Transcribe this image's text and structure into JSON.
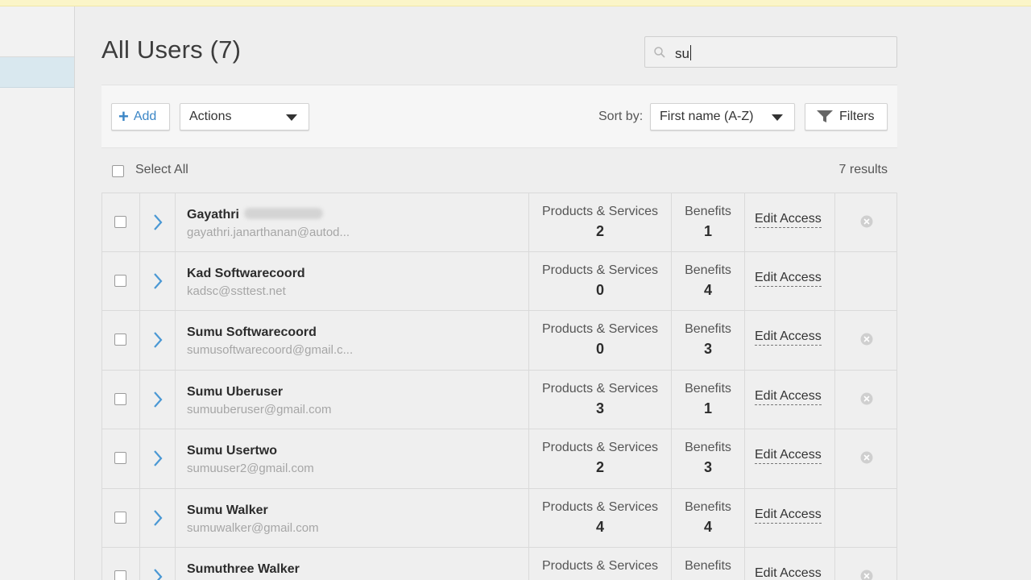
{
  "page": {
    "title": "All Users (7)"
  },
  "search": {
    "value": "su"
  },
  "toolbar": {
    "add_label": "Add",
    "actions_label": "Actions",
    "sort_label": "Sort by:",
    "sort_value": "First name (A-Z)",
    "filters_label": "Filters"
  },
  "select_bar": {
    "select_all_label": "Select All",
    "results_label": "7 results"
  },
  "table": {
    "products_label": "Products & Services",
    "benefits_label": "Benefits",
    "edit_label": "Edit Access",
    "rows": [
      {
        "name": "Gayathri",
        "email": "gayathri.janarthanan@autod...",
        "products": "2",
        "benefits": "1",
        "deletable": true,
        "redacted": true
      },
      {
        "name": "Kad Softwarecoord",
        "email": "kadsc@ssttest.net",
        "products": "0",
        "benefits": "4",
        "deletable": false
      },
      {
        "name": "Sumu Softwarecoord",
        "email": "sumusoftwarecoord@gmail.c...",
        "products": "0",
        "benefits": "3",
        "deletable": true
      },
      {
        "name": "Sumu Uberuser",
        "email": "sumuuberuser@gmail.com",
        "products": "3",
        "benefits": "1",
        "deletable": true
      },
      {
        "name": "Sumu Usertwo",
        "email": "sumuuser2@gmail.com",
        "products": "2",
        "benefits": "3",
        "deletable": true
      },
      {
        "name": "Sumu Walker",
        "email": "sumuwalker@gmail.com",
        "products": "4",
        "benefits": "4",
        "deletable": false
      },
      {
        "name": "Sumuthree Walker",
        "email": "",
        "products": "",
        "benefits": "",
        "deletable": true
      }
    ]
  },
  "colors": {
    "accent": "#3b86c6",
    "sidebar_active": "#d9e8ef",
    "top_banner": "#fbf5c8"
  }
}
